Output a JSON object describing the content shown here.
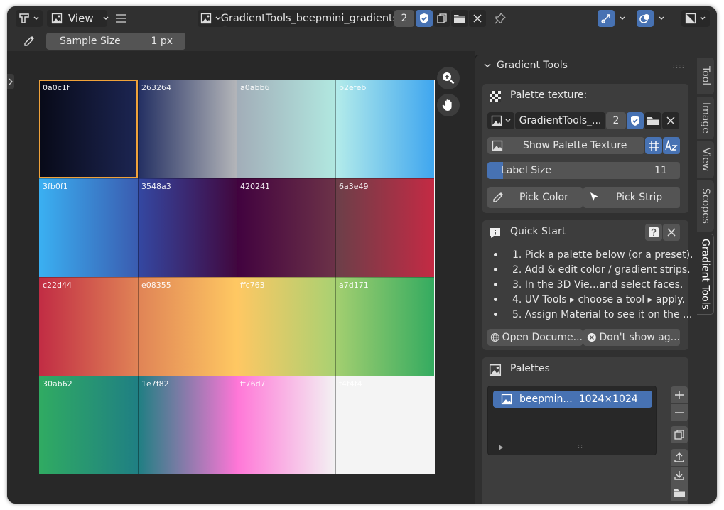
{
  "header": {
    "view_menu_label": "View",
    "image_name": "GradientTools_beepmini_gradients",
    "users_count": "2"
  },
  "toolbar": {
    "sample_size_label": "Sample Size",
    "sample_size_value": "1 px"
  },
  "palette_grid": {
    "swatches": [
      {
        "hex": "0a0c1f",
        "from": "#080a18",
        "to": "#1c2552"
      },
      {
        "hex": "263264",
        "from": "#232f62",
        "to": "#b3b5b9"
      },
      {
        "hex": "a0abb6",
        "from": "#a2adb8",
        "to": "#b1e8e0"
      },
      {
        "hex": "b2efeb",
        "from": "#b4ecea",
        "to": "#3fa6ef"
      },
      {
        "hex": "3fb0f1",
        "from": "#3ab0f2",
        "to": "#3a5cb0"
      },
      {
        "hex": "3548a3",
        "from": "#3448a2",
        "to": "#41083f"
      },
      {
        "hex": "420241",
        "from": "#41023f",
        "to": "#6c3248"
      },
      {
        "hex": "6a3e49",
        "from": "#6b3f49",
        "to": "#c42a44"
      },
      {
        "hex": "c22d44",
        "from": "#c12c44",
        "to": "#e08356"
      },
      {
        "hex": "e08355",
        "from": "#e08356",
        "to": "#fec862"
      },
      {
        "hex": "ffc763",
        "from": "#ffc763",
        "to": "#a9d172"
      },
      {
        "hex": "a7d171",
        "from": "#a4cf70",
        "to": "#34ab60"
      },
      {
        "hex": "30ab62",
        "from": "#30ab62",
        "to": "#1f7f83"
      },
      {
        "hex": "1e7f82",
        "from": "#1e7f82",
        "to": "#fc76d6"
      },
      {
        "hex": "ff76d7",
        "from": "#ff76d7",
        "to": "#f3f2f3"
      },
      {
        "hex": "f4f4f4",
        "from": "#f4f4f4",
        "to": "#f4f4f4"
      }
    ]
  },
  "gradient_tools_panel": {
    "title": "Gradient Tools",
    "palette_texture_label": "Palette texture:",
    "texture_name": "GradientTools_...",
    "texture_users": "2",
    "show_palette_texture_label": "Show Palette Texture",
    "label_size_label": "Label Size",
    "label_size_value": "11",
    "label_size_fraction": 0.08,
    "pick_color_label": "Pick Color",
    "pick_strip_label": "Pick Strip"
  },
  "quick_start": {
    "title": "Quick Start",
    "items": [
      "1. Pick a palette below (or a preset).",
      "2. Add & edit color / gradient strips.",
      "3. In the 3D Vie...and select faces.",
      "4. UV Tools ▸ choose a tool ▸ apply.",
      "5. Assign Material to see it on the ..."
    ],
    "open_docs_label": "Open Docume...",
    "dont_show_label": "Don't show ag..."
  },
  "palettes": {
    "title": "Palettes",
    "items": [
      {
        "name": "beepmin...",
        "size": "1024×1024"
      }
    ]
  },
  "side_tabs": [
    "Tool",
    "Image",
    "View",
    "Scopes",
    "Gradient Tools"
  ],
  "colors": {
    "accent_blue": "#4772b3",
    "selection_orange": "#f0a23a",
    "panel_bg": "#3d3d3d",
    "window_bg": "#303030"
  },
  "icons": [
    "editor-type-icon",
    "image-icon",
    "hamburger-icon",
    "shield-icon",
    "duplicate-icon",
    "folder-icon",
    "close-icon",
    "pin-icon",
    "gizmo-icon",
    "overlay-icon",
    "display-channels-icon",
    "eyedropper-icon",
    "zoom-icon",
    "hand-icon",
    "checker-icon",
    "grid-icon",
    "sort-az-icon",
    "info-icon",
    "help-icon",
    "globe-icon",
    "cancel-icon",
    "plus-icon",
    "minus-icon",
    "copy-icon",
    "upload-icon",
    "download-icon"
  ]
}
